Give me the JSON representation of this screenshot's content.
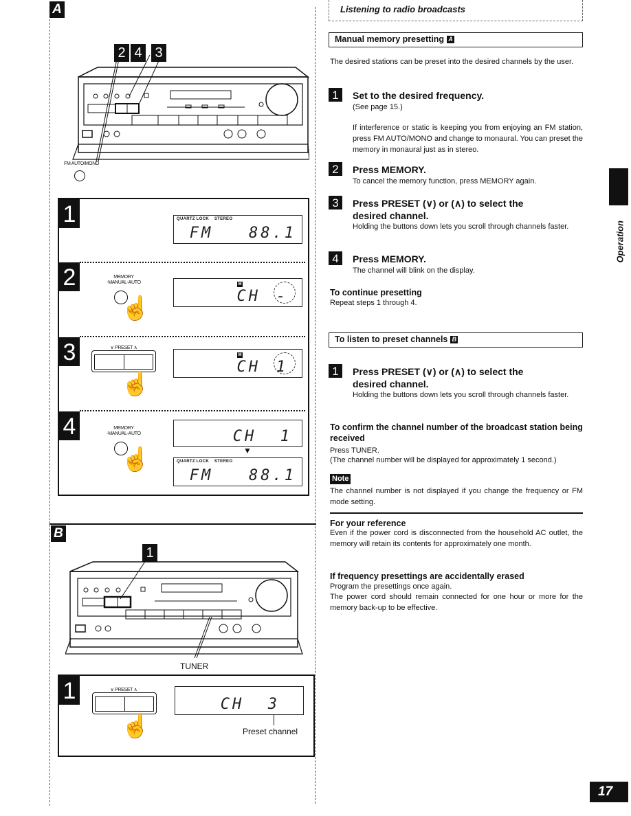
{
  "header": {
    "section_title": "Listening to radio broadcasts"
  },
  "side_tab": {
    "label": "Operation"
  },
  "page_number": "17",
  "figure_a": {
    "label": "A",
    "callouts": [
      "2",
      "4",
      "3"
    ],
    "fm_auto_mono_label": "FM AUTO/MONO",
    "steps": [
      {
        "number": "1",
        "display": {
          "indicators": "QUARTZ LOCK    STEREO",
          "text": "FM   88.1"
        }
      },
      {
        "number": "2",
        "button_label_line1": "MEMORY",
        "button_label_line2": "-MANUAL-AUTO",
        "display": {
          "memory_indicator": "M",
          "text": "CH",
          "blinking": "-"
        }
      },
      {
        "number": "3",
        "button_label": "∨ PRESET ∧",
        "display": {
          "memory_indicator": "M",
          "text": "CH",
          "blinking": "1"
        }
      },
      {
        "number": "4",
        "button_label_line1": "MEMORY",
        "button_label_line2": "-MANUAL-AUTO",
        "display_top": {
          "text": "CH  1"
        },
        "display_bottom": {
          "indicators": "QUARTZ LOCK    STEREO",
          "text": "FM   88.1"
        }
      }
    ]
  },
  "figure_b": {
    "label": "B",
    "callout": "1",
    "tuner_label": "TUNER",
    "step": {
      "number": "1",
      "button_label": "∨ PRESET ∧",
      "display": {
        "text": "CH  3"
      },
      "annotation": "Preset channel"
    }
  },
  "manual_memory": {
    "heading": "Manual memory presetting",
    "heading_badge": "A",
    "intro": "The desired stations can be preset into the desired channels by the user.",
    "steps": [
      {
        "number": "1",
        "title": "Set to the desired frequency.",
        "desc": "(See page 15.)",
        "extra": "If interference or static is keeping you from enjoying an FM station, press FM AUTO/MONO and change to monaural. You can preset the memory in monaural just as in stereo."
      },
      {
        "number": "2",
        "title": "Press MEMORY.",
        "desc": "To cancel the memory function, press MEMORY again."
      },
      {
        "number": "3",
        "title": "Press PRESET (∨) or (∧) to select the desired channel.",
        "desc": "Holding the buttons down lets you scroll through channels faster."
      },
      {
        "number": "4",
        "title": "Press MEMORY.",
        "desc": "The channel will blink on the display."
      }
    ],
    "continue_heading": "To continue presetting",
    "continue_text": "Repeat steps 1 through 4."
  },
  "listen_preset": {
    "heading": "To listen to preset channels",
    "heading_badge": "B",
    "steps": [
      {
        "number": "1",
        "title": "Press PRESET (∨) or (∧) to select the desired channel.",
        "desc": "Holding the buttons down lets you scroll through channels faster."
      }
    ],
    "confirm_heading": "To confirm the channel number of the broadcast station being received",
    "confirm_line1": "Press TUNER.",
    "confirm_line2": "(The channel number will be displayed for approximately 1 second.)",
    "note_label": "Note",
    "note_text": "The channel number is not displayed if you change the frequency or FM mode setting."
  },
  "reference": {
    "heading": "For your reference",
    "text": "Even if the power cord is disconnected from the household AC outlet, the memory will retain its contents for approximately one month."
  },
  "erased": {
    "heading": "If frequency presettings are accidentally erased",
    "line1": "Program the presettings once again.",
    "line2": "The power cord should remain connected for one hour or more for the memory back-up to be effective."
  }
}
